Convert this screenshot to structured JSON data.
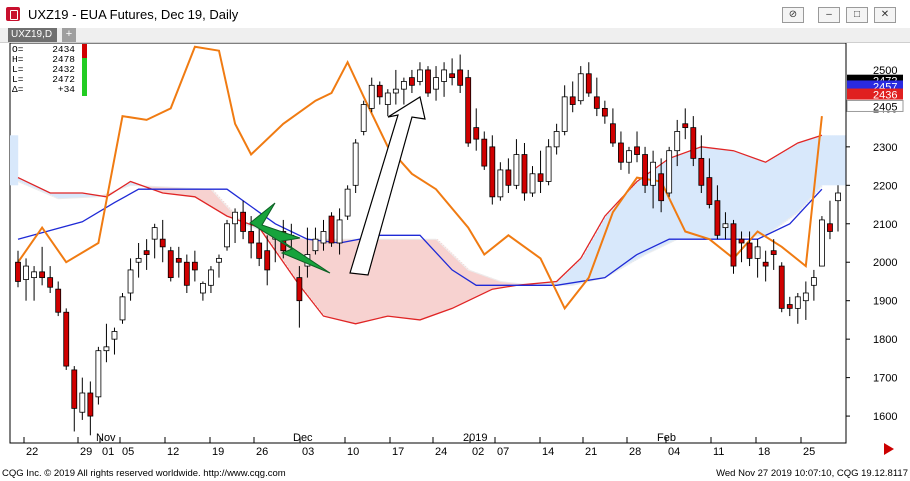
{
  "window": {
    "title": "UXZ19 - EUA Futures, Dec 19, Daily",
    "tab_label": "UXZ19,D",
    "tab_add": "+"
  },
  "footer": {
    "left": "CQG Inc. © 2019 All rights reserved worldwide. http://www.cqg.com",
    "right": "Wed Nov 27 2019 10:07:10, CQG 19.12.8117"
  },
  "colors": {
    "bull_candle": "#ffffff",
    "bear_candle": "#d00000",
    "candle_outline": "#000000",
    "tenkan": "#f07b12",
    "kijun": "#1f2ad6",
    "span_a": "#e02525",
    "cloud_bull": "#d8e8fb",
    "cloud_bear": "#f7d2d0",
    "lightning": "#17a33c"
  },
  "chart_data": {
    "type": "candlestick",
    "symbol": "UXZ19",
    "ylim": [
      1530,
      2570
    ],
    "y_ticks": [
      1600,
      1700,
      1800,
      1900,
      2000,
      2100,
      2200,
      2300,
      2400,
      2500
    ],
    "x_ticks": [
      "22",
      "29",
      "01",
      "05",
      "12",
      "19",
      "26",
      "03",
      "10",
      "17",
      "24",
      "02",
      "07",
      "14",
      "21",
      "28",
      "04",
      "11",
      "18",
      "25"
    ],
    "month_labels": [
      "Nov",
      "Dec",
      "2019",
      "Feb"
    ],
    "ohlc_box": {
      "labels": [
        "O=",
        "H=",
        "L=",
        "L=",
        "Δ="
      ],
      "values": [
        "2434",
        "2478",
        "2432",
        "2472",
        "+34"
      ]
    },
    "price_tags": [
      {
        "value": 2500,
        "text": "2500",
        "style": "axis"
      },
      {
        "value": 2472,
        "text": "2472",
        "style": "last"
      },
      {
        "value": 2457,
        "text": "2457",
        "style": "kijun"
      },
      {
        "value": 2436,
        "text": "2436",
        "style": "span"
      },
      {
        "value": 2405,
        "text": "2405",
        "style": "plain"
      }
    ],
    "candles": [
      {
        "o": 2000,
        "h": 2030,
        "l": 1935,
        "c": 1950
      },
      {
        "o": 1955,
        "h": 2010,
        "l": 1900,
        "c": 1990
      },
      {
        "o": 1960,
        "h": 1990,
        "l": 1900,
        "c": 1975
      },
      {
        "o": 1975,
        "h": 2040,
        "l": 1940,
        "c": 1960
      },
      {
        "o": 1960,
        "h": 1990,
        "l": 1920,
        "c": 1935
      },
      {
        "o": 1930,
        "h": 1950,
        "l": 1860,
        "c": 1870
      },
      {
        "o": 1870,
        "h": 1880,
        "l": 1720,
        "c": 1730
      },
      {
        "o": 1720,
        "h": 1730,
        "l": 1560,
        "c": 1620
      },
      {
        "o": 1610,
        "h": 1700,
        "l": 1590,
        "c": 1660
      },
      {
        "o": 1660,
        "h": 1690,
        "l": 1550,
        "c": 1600
      },
      {
        "o": 1650,
        "h": 1780,
        "l": 1630,
        "c": 1770
      },
      {
        "o": 1770,
        "h": 1840,
        "l": 1740,
        "c": 1780
      },
      {
        "o": 1800,
        "h": 1830,
        "l": 1760,
        "c": 1820
      },
      {
        "o": 1850,
        "h": 1920,
        "l": 1840,
        "c": 1910
      },
      {
        "o": 1920,
        "h": 2010,
        "l": 1900,
        "c": 1980
      },
      {
        "o": 2000,
        "h": 2050,
        "l": 1960,
        "c": 2010
      },
      {
        "o": 2030,
        "h": 2060,
        "l": 1980,
        "c": 2020
      },
      {
        "o": 2060,
        "h": 2100,
        "l": 2010,
        "c": 2090
      },
      {
        "o": 2060,
        "h": 2110,
        "l": 2000,
        "c": 2040
      },
      {
        "o": 2030,
        "h": 2040,
        "l": 1950,
        "c": 1960
      },
      {
        "o": 2010,
        "h": 2040,
        "l": 1960,
        "c": 2000
      },
      {
        "o": 2000,
        "h": 2020,
        "l": 1920,
        "c": 1940
      },
      {
        "o": 2000,
        "h": 2030,
        "l": 1950,
        "c": 1980
      },
      {
        "o": 1920,
        "h": 1950,
        "l": 1900,
        "c": 1945
      },
      {
        "o": 1940,
        "h": 1990,
        "l": 1920,
        "c": 1980
      },
      {
        "o": 2000,
        "h": 2020,
        "l": 1960,
        "c": 2010
      },
      {
        "o": 2040,
        "h": 2110,
        "l": 2030,
        "c": 2100
      },
      {
        "o": 2100,
        "h": 2140,
        "l": 2050,
        "c": 2130
      },
      {
        "o": 2130,
        "h": 2160,
        "l": 2060,
        "c": 2080
      },
      {
        "o": 2080,
        "h": 2120,
        "l": 2010,
        "c": 2050
      },
      {
        "o": 2050,
        "h": 2090,
        "l": 1990,
        "c": 2010
      },
      {
        "o": 2030,
        "h": 2070,
        "l": 1940,
        "c": 1980
      },
      {
        "o": 2060,
        "h": 2080,
        "l": 2000,
        "c": 2070
      },
      {
        "o": 2080,
        "h": 2110,
        "l": 2010,
        "c": 2030
      },
      {
        "o": 2060,
        "h": 2100,
        "l": 2030,
        "c": 2070
      },
      {
        "o": 1960,
        "h": 1990,
        "l": 1830,
        "c": 1900
      },
      {
        "o": 1990,
        "h": 2090,
        "l": 1960,
        "c": 2020
      },
      {
        "o": 2030,
        "h": 2090,
        "l": 2020,
        "c": 2060
      },
      {
        "o": 2050,
        "h": 2110,
        "l": 2030,
        "c": 2080
      },
      {
        "o": 2120,
        "h": 2130,
        "l": 2040,
        "c": 2050
      },
      {
        "o": 2050,
        "h": 2140,
        "l": 2020,
        "c": 2110
      },
      {
        "o": 2120,
        "h": 2200,
        "l": 2110,
        "c": 2190
      },
      {
        "o": 2200,
        "h": 2320,
        "l": 2180,
        "c": 2310
      },
      {
        "o": 2340,
        "h": 2420,
        "l": 2330,
        "c": 2410
      },
      {
        "o": 2400,
        "h": 2480,
        "l": 2390,
        "c": 2460
      },
      {
        "o": 2460,
        "h": 2470,
        "l": 2410,
        "c": 2430
      },
      {
        "o": 2410,
        "h": 2450,
        "l": 2380,
        "c": 2440
      },
      {
        "o": 2440,
        "h": 2500,
        "l": 2410,
        "c": 2450
      },
      {
        "o": 2450,
        "h": 2480,
        "l": 2410,
        "c": 2470
      },
      {
        "o": 2480,
        "h": 2500,
        "l": 2440,
        "c": 2460
      },
      {
        "o": 2470,
        "h": 2520,
        "l": 2460,
        "c": 2500
      },
      {
        "o": 2500,
        "h": 2510,
        "l": 2430,
        "c": 2440
      },
      {
        "o": 2450,
        "h": 2510,
        "l": 2420,
        "c": 2480
      },
      {
        "o": 2470,
        "h": 2520,
        "l": 2430,
        "c": 2500
      },
      {
        "o": 2490,
        "h": 2530,
        "l": 2460,
        "c": 2480
      },
      {
        "o": 2500,
        "h": 2540,
        "l": 2440,
        "c": 2460
      },
      {
        "o": 2480,
        "h": 2500,
        "l": 2300,
        "c": 2310
      },
      {
        "o": 2350,
        "h": 2400,
        "l": 2290,
        "c": 2320
      },
      {
        "o": 2320,
        "h": 2340,
        "l": 2240,
        "c": 2250
      },
      {
        "o": 2300,
        "h": 2330,
        "l": 2150,
        "c": 2170
      },
      {
        "o": 2170,
        "h": 2260,
        "l": 2160,
        "c": 2240
      },
      {
        "o": 2240,
        "h": 2270,
        "l": 2180,
        "c": 2200
      },
      {
        "o": 2200,
        "h": 2320,
        "l": 2190,
        "c": 2280
      },
      {
        "o": 2280,
        "h": 2310,
        "l": 2160,
        "c": 2180
      },
      {
        "o": 2180,
        "h": 2250,
        "l": 2170,
        "c": 2230
      },
      {
        "o": 2230,
        "h": 2290,
        "l": 2180,
        "c": 2210
      },
      {
        "o": 2210,
        "h": 2320,
        "l": 2200,
        "c": 2300
      },
      {
        "o": 2300,
        "h": 2360,
        "l": 2280,
        "c": 2340
      },
      {
        "o": 2340,
        "h": 2460,
        "l": 2330,
        "c": 2430
      },
      {
        "o": 2430,
        "h": 2470,
        "l": 2390,
        "c": 2410
      },
      {
        "o": 2420,
        "h": 2510,
        "l": 2410,
        "c": 2490
      },
      {
        "o": 2490,
        "h": 2520,
        "l": 2430,
        "c": 2440
      },
      {
        "o": 2430,
        "h": 2480,
        "l": 2380,
        "c": 2400
      },
      {
        "o": 2400,
        "h": 2420,
        "l": 2360,
        "c": 2380
      },
      {
        "o": 2360,
        "h": 2400,
        "l": 2300,
        "c": 2310
      },
      {
        "o": 2310,
        "h": 2340,
        "l": 2240,
        "c": 2260
      },
      {
        "o": 2260,
        "h": 2300,
        "l": 2230,
        "c": 2290
      },
      {
        "o": 2300,
        "h": 2340,
        "l": 2260,
        "c": 2280
      },
      {
        "o": 2280,
        "h": 2300,
        "l": 2180,
        "c": 2200
      },
      {
        "o": 2200,
        "h": 2290,
        "l": 2140,
        "c": 2260
      },
      {
        "o": 2230,
        "h": 2270,
        "l": 2130,
        "c": 2160
      },
      {
        "o": 2180,
        "h": 2300,
        "l": 2170,
        "c": 2290
      },
      {
        "o": 2290,
        "h": 2370,
        "l": 2250,
        "c": 2340
      },
      {
        "o": 2360,
        "h": 2400,
        "l": 2320,
        "c": 2350
      },
      {
        "o": 2350,
        "h": 2380,
        "l": 2250,
        "c": 2270
      },
      {
        "o": 2270,
        "h": 2330,
        "l": 2180,
        "c": 2200
      },
      {
        "o": 2220,
        "h": 2270,
        "l": 2140,
        "c": 2150
      },
      {
        "o": 2160,
        "h": 2200,
        "l": 2060,
        "c": 2070
      },
      {
        "o": 2090,
        "h": 2130,
        "l": 2060,
        "c": 2100
      },
      {
        "o": 2100,
        "h": 2110,
        "l": 1970,
        "c": 1990
      },
      {
        "o": 2060,
        "h": 2080,
        "l": 2000,
        "c": 2050
      },
      {
        "o": 2050,
        "h": 2080,
        "l": 1990,
        "c": 2010
      },
      {
        "o": 2010,
        "h": 2060,
        "l": 1960,
        "c": 2040
      },
      {
        "o": 2000,
        "h": 2030,
        "l": 1950,
        "c": 1990
      },
      {
        "o": 2030,
        "h": 2060,
        "l": 1980,
        "c": 2020
      },
      {
        "o": 1990,
        "h": 2000,
        "l": 1870,
        "c": 1880
      },
      {
        "o": 1890,
        "h": 1910,
        "l": 1860,
        "c": 1880
      },
      {
        "o": 1880,
        "h": 1920,
        "l": 1840,
        "c": 1910
      },
      {
        "o": 1900,
        "h": 1950,
        "l": 1850,
        "c": 1920
      },
      {
        "o": 1940,
        "h": 1980,
        "l": 1900,
        "c": 1960
      },
      {
        "o": 1990,
        "h": 2120,
        "l": 1990,
        "c": 2110
      },
      {
        "o": 2100,
        "h": 2160,
        "l": 2060,
        "c": 2080
      },
      {
        "o": 2160,
        "h": 2200,
        "l": 2080,
        "c": 2180
      }
    ],
    "tenkan": [
      [
        0,
        2000
      ],
      [
        3,
        2090
      ],
      [
        6,
        2000
      ],
      [
        10,
        2050
      ],
      [
        13,
        2380
      ],
      [
        16,
        2370
      ],
      [
        19,
        2400
      ],
      [
        22,
        2560
      ],
      [
        25,
        2550
      ],
      [
        27,
        2360
      ],
      [
        29,
        2280
      ],
      [
        33,
        2360
      ],
      [
        37,
        2420
      ],
      [
        39,
        2440
      ],
      [
        41,
        2520
      ],
      [
        43,
        2430
      ],
      [
        46,
        2300
      ],
      [
        49,
        2230
      ],
      [
        52,
        2190
      ],
      [
        56,
        2090
      ],
      [
        58,
        2020
      ],
      [
        61,
        2070
      ],
      [
        65,
        2010
      ],
      [
        68,
        1880
      ],
      [
        71,
        1960
      ],
      [
        74,
        2130
      ],
      [
        77,
        2220
      ],
      [
        80,
        2210
      ],
      [
        83,
        2080
      ],
      [
        86,
        2060
      ],
      [
        89,
        2010
      ],
      [
        92,
        2080
      ],
      [
        95,
        2040
      ],
      [
        98,
        1990
      ],
      [
        100,
        2380
      ]
    ],
    "kijun": [
      [
        0,
        2060
      ],
      [
        8,
        2105
      ],
      [
        12,
        2155
      ],
      [
        15,
        2190
      ],
      [
        20,
        2190
      ],
      [
        26,
        2190
      ],
      [
        32,
        2100
      ],
      [
        36,
        2060
      ],
      [
        40,
        2050
      ],
      [
        45,
        2070
      ],
      [
        50,
        2070
      ],
      [
        54,
        1980
      ],
      [
        57,
        1940
      ],
      [
        61,
        1940
      ],
      [
        67,
        1940
      ],
      [
        73,
        1960
      ],
      [
        77,
        2020
      ],
      [
        81,
        2060
      ],
      [
        88,
        2060
      ],
      [
        92,
        2060
      ],
      [
        96,
        2100
      ],
      [
        100,
        2190
      ]
    ],
    "span_a": [
      [
        0,
        2220
      ],
      [
        4,
        2180
      ],
      [
        8,
        2180
      ],
      [
        11,
        2170
      ],
      [
        14,
        2210
      ],
      [
        18,
        2180
      ],
      [
        22,
        2170
      ],
      [
        26,
        2120
      ],
      [
        30,
        2090
      ],
      [
        35,
        1940
      ],
      [
        38,
        1860
      ],
      [
        42,
        1840
      ],
      [
        46,
        1860
      ],
      [
        50,
        1850
      ],
      [
        54,
        1880
      ],
      [
        59,
        1930
      ],
      [
        62,
        1940
      ],
      [
        67,
        1950
      ],
      [
        70,
        2010
      ],
      [
        73,
        2120
      ],
      [
        77,
        2210
      ],
      [
        81,
        2270
      ],
      [
        85,
        2300
      ],
      [
        89,
        2290
      ],
      [
        93,
        2260
      ],
      [
        97,
        2310
      ],
      [
        100,
        2330
      ]
    ],
    "cloud_other": [
      [
        0,
        2210
      ],
      [
        5,
        2165
      ],
      [
        10,
        2170
      ],
      [
        14,
        2200
      ],
      [
        19,
        2195
      ],
      [
        24,
        2190
      ],
      [
        28,
        2100
      ],
      [
        32,
        2070
      ],
      [
        36,
        2060
      ],
      [
        41,
        2060
      ],
      [
        46,
        2060
      ],
      [
        52,
        2060
      ],
      [
        56,
        1980
      ],
      [
        60,
        1950
      ],
      [
        64,
        1940
      ],
      [
        69,
        1940
      ],
      [
        73,
        1960
      ],
      [
        78,
        2020
      ],
      [
        82,
        2060
      ],
      [
        87,
        2060
      ],
      [
        93,
        2070
      ],
      [
        97,
        2130
      ],
      [
        100,
        2200
      ]
    ]
  }
}
